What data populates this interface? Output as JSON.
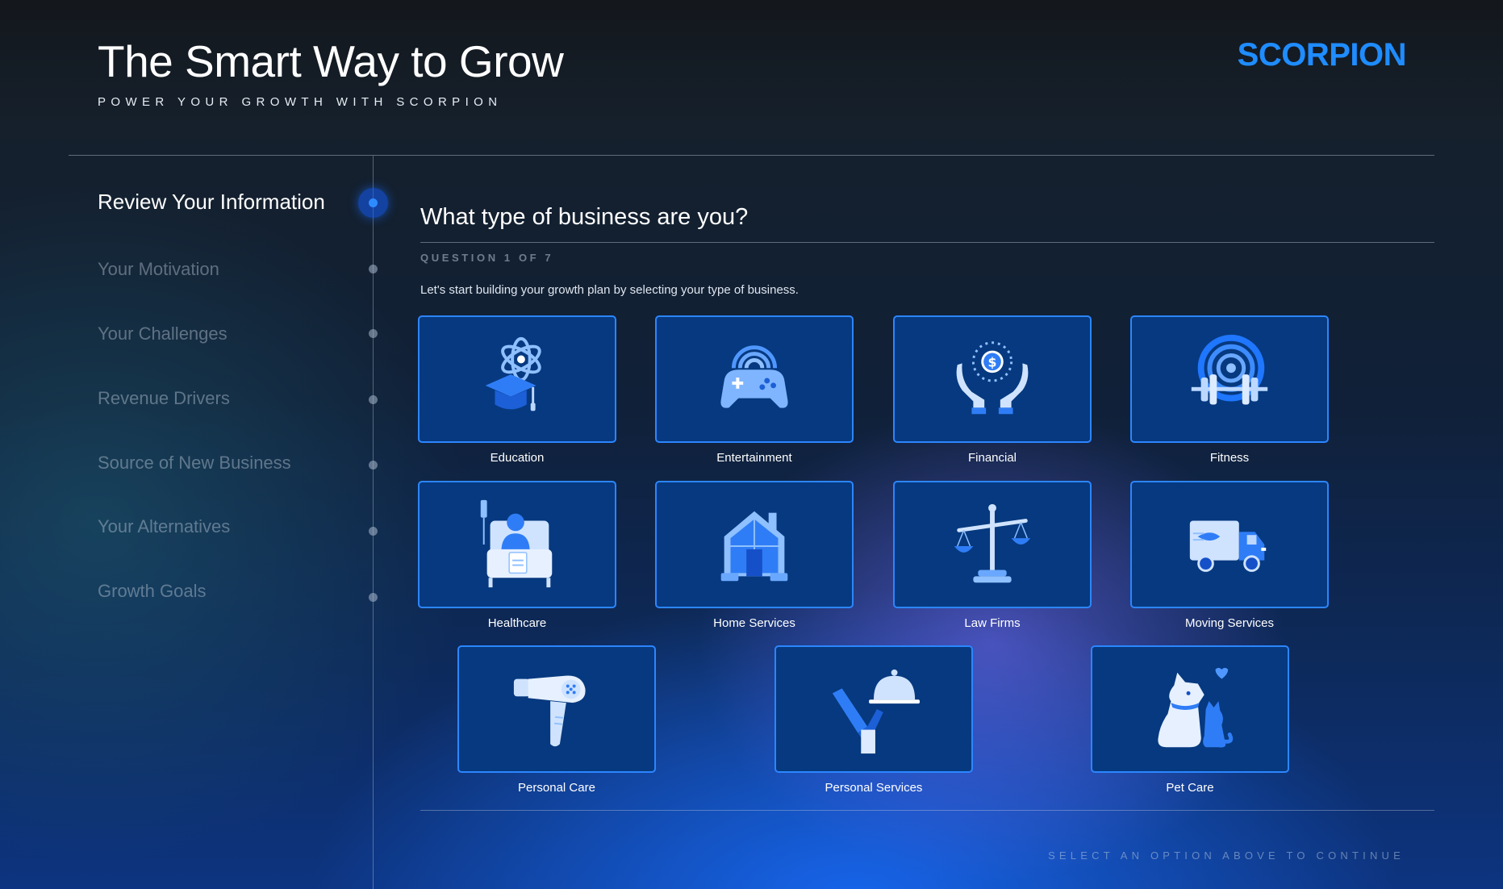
{
  "header": {
    "title": "The Smart Way to Grow",
    "subtitle": "POWER YOUR GROWTH WITH SCORPION",
    "brand": "SCORPION",
    "brand_color": "#1f8cff"
  },
  "sidebar": {
    "active_index": 0,
    "steps": [
      {
        "label": "Review Your Information",
        "active": true
      },
      {
        "label": "Your Motivation",
        "active": false
      },
      {
        "label": "Your Challenges",
        "active": false
      },
      {
        "label": "Revenue Drivers",
        "active": false
      },
      {
        "label": "Source of New Business",
        "active": false
      },
      {
        "label": "Your Alternatives",
        "active": false
      },
      {
        "label": "Growth Goals",
        "active": false
      }
    ]
  },
  "question": {
    "title": "What type of business are you?",
    "counter": "QUESTION 1 OF 7",
    "description": "Let's start building your growth plan by selecting your type of business."
  },
  "options": [
    {
      "label": "Education",
      "icon": "graduation-cap-atom-icon"
    },
    {
      "label": "Entertainment",
      "icon": "game-controller-icon"
    },
    {
      "label": "Financial",
      "icon": "hands-coin-icon"
    },
    {
      "label": "Fitness",
      "icon": "dumbbell-target-icon"
    },
    {
      "label": "Healthcare",
      "icon": "hospital-bed-icon"
    },
    {
      "label": "Home Services",
      "icon": "house-icon"
    },
    {
      "label": "Law Firms",
      "icon": "scales-icon"
    },
    {
      "label": "Moving Services",
      "icon": "moving-truck-icon"
    },
    {
      "label": "Personal Care",
      "icon": "hair-dryer-icon"
    },
    {
      "label": "Personal Services",
      "icon": "serving-cloche-icon"
    },
    {
      "label": "Pet Care",
      "icon": "dog-cat-icon"
    }
  ],
  "footer": {
    "hint": "SELECT AN OPTION ABOVE TO CONTINUE"
  },
  "colors": {
    "card_background": "#06397f",
    "card_border": "#2c86ff",
    "accent": "#2e8bff"
  }
}
